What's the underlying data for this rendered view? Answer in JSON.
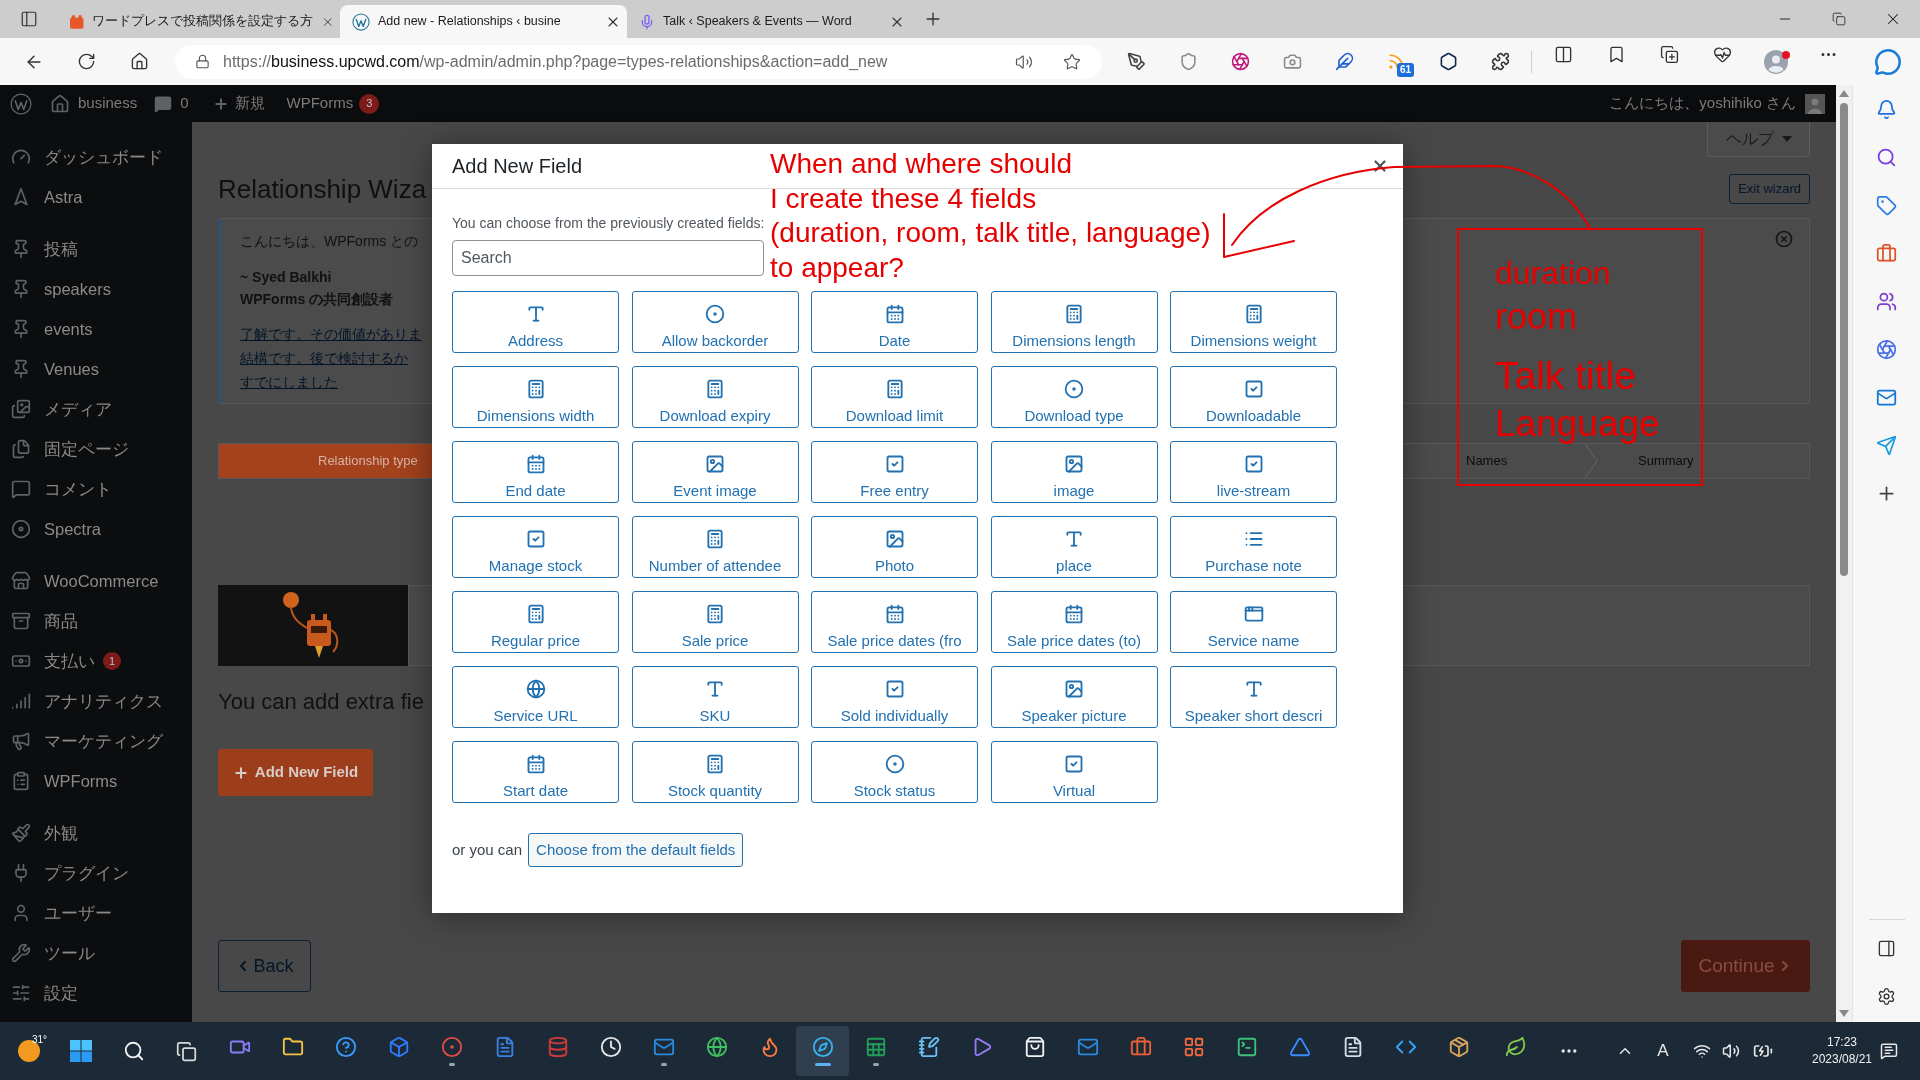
{
  "browser": {
    "tabs": [
      {
        "title": "ワードプレスで投稿関係を設定する方",
        "selected": false
      },
      {
        "title": "Add new - Relationships ‹ busine",
        "selected": true
      },
      {
        "title": "Talk ‹ Speakers & Events — Word",
        "selected": false
      }
    ],
    "url": {
      "scheme": "https://",
      "host": "business.upcwd.com",
      "path": "/wp-admin/admin.php?page=types-relationships&action=add_new"
    },
    "feed_count": "61",
    "profile_alert": true
  },
  "admin_bar": {
    "site": "business",
    "comments": "0",
    "new": "新規",
    "forms": "WPForms",
    "forms_count": "3",
    "greeting": "こんにちは、yoshihiko さん"
  },
  "sidebar": {
    "groups": [
      [
        {
          "label": "ダッシュボード"
        },
        {
          "label": "Astra"
        }
      ],
      [
        {
          "label": "投稿"
        },
        {
          "label": "speakers"
        },
        {
          "label": "events"
        },
        {
          "label": "Venues"
        },
        {
          "label": "メディア"
        },
        {
          "label": "固定ページ"
        },
        {
          "label": "コメント"
        },
        {
          "label": "Spectra"
        }
      ],
      [
        {
          "label": "WooCommerce"
        },
        {
          "label": "商品"
        },
        {
          "label": "支払い",
          "badge": "1"
        },
        {
          "label": "アナリティクス"
        },
        {
          "label": "マーケティング"
        },
        {
          "label": "WPForms"
        }
      ],
      [
        {
          "label": "外観"
        },
        {
          "label": "プラグイン"
        },
        {
          "label": "ユーザー"
        },
        {
          "label": "ツール"
        },
        {
          "label": "設定"
        }
      ]
    ]
  },
  "page": {
    "help": "ヘルプ",
    "title": "Relationship Wiza",
    "exit": "Exit wizard",
    "notice": {
      "greeting": "こんにちは、WPForms との",
      "signature": "~ Syed Balkhi",
      "role": "WPForms の共同創設者",
      "links": [
        "了解です。その価値がありま",
        "結構です。後で検討するか",
        "すでにしました"
      ]
    },
    "steps": [
      {
        "label": "Relationship type",
        "selected": true
      },
      {
        "label": "Names",
        "selected": false
      },
      {
        "label": "Summary",
        "selected": false
      }
    ],
    "extra_text": "You can add extra fie",
    "add_button": "Add New Field",
    "back": "Back",
    "continue": "Continue"
  },
  "modal": {
    "title": "Add New Field",
    "intro": "You can choose from the previously created fields:",
    "search": {
      "placeholder": "Search"
    },
    "fields": [
      {
        "label": "Address",
        "kind": "text"
      },
      {
        "label": "Allow backorder",
        "kind": "radio"
      },
      {
        "label": "Date",
        "kind": "date"
      },
      {
        "label": "Dimensions length",
        "kind": "number"
      },
      {
        "label": "Dimensions weight",
        "kind": "number"
      },
      {
        "label": "Dimensions width",
        "kind": "number"
      },
      {
        "label": "Download expiry",
        "kind": "number"
      },
      {
        "label": "Download limit",
        "kind": "number"
      },
      {
        "label": "Download type",
        "kind": "radio"
      },
      {
        "label": "Downloadable",
        "kind": "checkbox"
      },
      {
        "label": "End date",
        "kind": "date"
      },
      {
        "label": "Event image",
        "kind": "image"
      },
      {
        "label": "Free entry",
        "kind": "checkbox"
      },
      {
        "label": "image",
        "kind": "image"
      },
      {
        "label": "live-stream",
        "kind": "checkbox"
      },
      {
        "label": "Manage stock",
        "kind": "checkbox"
      },
      {
        "label": "Number of attendee",
        "kind": "number"
      },
      {
        "label": "Photo",
        "kind": "image"
      },
      {
        "label": "place",
        "kind": "text"
      },
      {
        "label": "Purchase note",
        "kind": "textarea"
      },
      {
        "label": "Regular price",
        "kind": "number"
      },
      {
        "label": "Sale price",
        "kind": "number"
      },
      {
        "label": "Sale price dates (fro",
        "kind": "date"
      },
      {
        "label": "Sale price dates (to)",
        "kind": "date"
      },
      {
        "label": "Service name",
        "kind": "embed"
      },
      {
        "label": "Service URL",
        "kind": "url"
      },
      {
        "label": "SKU",
        "kind": "text"
      },
      {
        "label": "Sold individually",
        "kind": "checkbox"
      },
      {
        "label": "Speaker picture",
        "kind": "image"
      },
      {
        "label": "Speaker short descri",
        "kind": "text"
      },
      {
        "label": "Start date",
        "kind": "date"
      },
      {
        "label": "Stock quantity",
        "kind": "number"
      },
      {
        "label": "Stock status",
        "kind": "radio"
      },
      {
        "label": "Virtual",
        "kind": "checkbox"
      }
    ],
    "footer_text": "or you can",
    "default_button": "Choose from the default fields"
  },
  "annotations": {
    "question": [
      "When and where should",
      "I create these 4 fields",
      "(duration, room, talk title, language)",
      "to appear?"
    ],
    "fields": [
      "duration",
      "room",
      "Talk title",
      "Language"
    ]
  },
  "taskbar": {
    "temperature": "31°",
    "apps": [
      {
        "running": false,
        "selected": false
      },
      {
        "running": false,
        "selected": false
      },
      {
        "running": false,
        "selected": false
      },
      {
        "running": false,
        "selected": false
      },
      {
        "running": true,
        "selected": false
      },
      {
        "running": false,
        "selected": false
      },
      {
        "running": false,
        "selected": false
      },
      {
        "running": false,
        "selected": false
      },
      {
        "running": true,
        "selected": false
      },
      {
        "running": false,
        "selected": false
      },
      {
        "running": false,
        "selected": false
      },
      {
        "running": true,
        "selected": true
      },
      {
        "running": true,
        "selected": false
      },
      {
        "running": false,
        "selected": false
      },
      {
        "running": false,
        "selected": false
      },
      {
        "running": false,
        "selected": false
      },
      {
        "running": false,
        "selected": false
      },
      {
        "running": false,
        "selected": false
      },
      {
        "running": false,
        "selected": false
      },
      {
        "running": false,
        "selected": false
      },
      {
        "running": false,
        "selected": false
      },
      {
        "running": false,
        "selected": false
      },
      {
        "running": false,
        "selected": false
      },
      {
        "running": false,
        "selected": false
      },
      {
        "running": false,
        "selected": false
      }
    ],
    "ime": "A",
    "time": "17:23",
    "date": "2023/08/21"
  }
}
